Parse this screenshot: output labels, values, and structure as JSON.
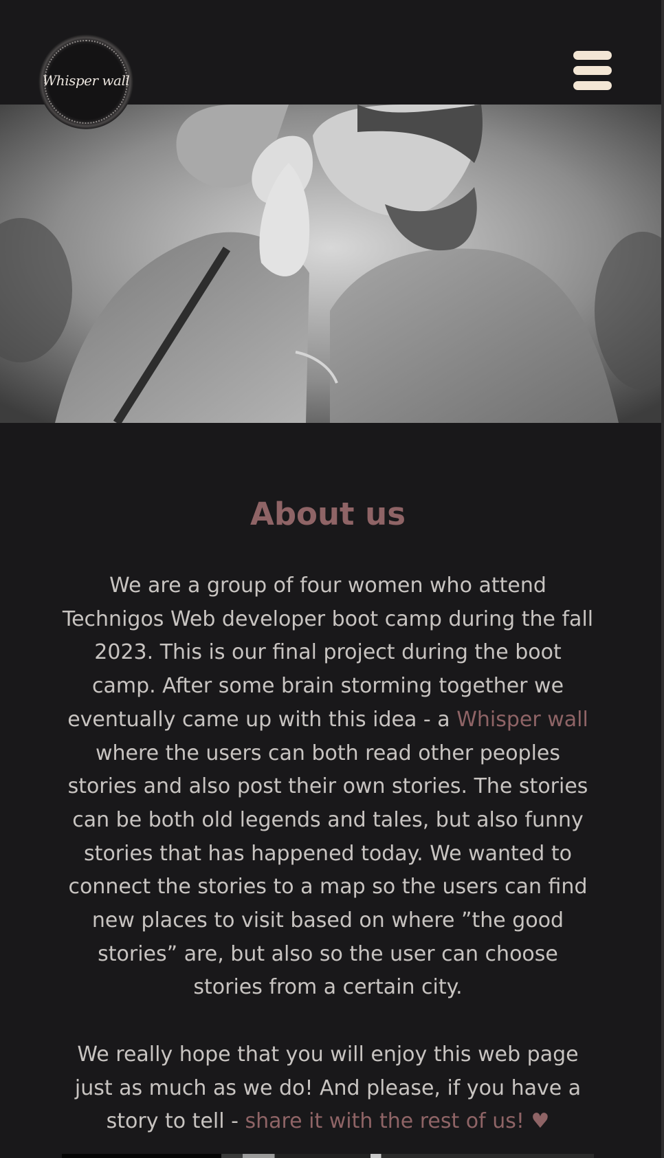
{
  "header": {
    "logo_text": "Whisper wall",
    "menu_icon": "hamburger-menu-icon"
  },
  "hero": {
    "image": "couple-whispering-photo"
  },
  "about": {
    "title": "About us",
    "paragraph1": {
      "before": "We are a group of four women who attend Technigos Web developer boot camp during the fall 2023. This is our final project during the boot camp. After some brain storming together we eventually came up with this idea - a ",
      "highlight": "Whisper wall",
      "after": " where the users can both read other peoples stories and also post their own stories. The stories can be both old legends and tales, but also funny stories that has happened today. We wanted to connect the stories to a map so the users can find new places to visit based on where ”the good stories” are, but also so the user can choose stories from a certain city."
    },
    "paragraph2": {
      "before": "We really hope that you will enjoy this web page just as much as we do! And please, if you have a story to tell - ",
      "link": "share it with the rest of us!",
      "heart": "♥"
    }
  },
  "colors": {
    "background": "#19181a",
    "accent": "#8f6466",
    "text": "#c8c4c1",
    "menu": "#f3e6d5"
  }
}
